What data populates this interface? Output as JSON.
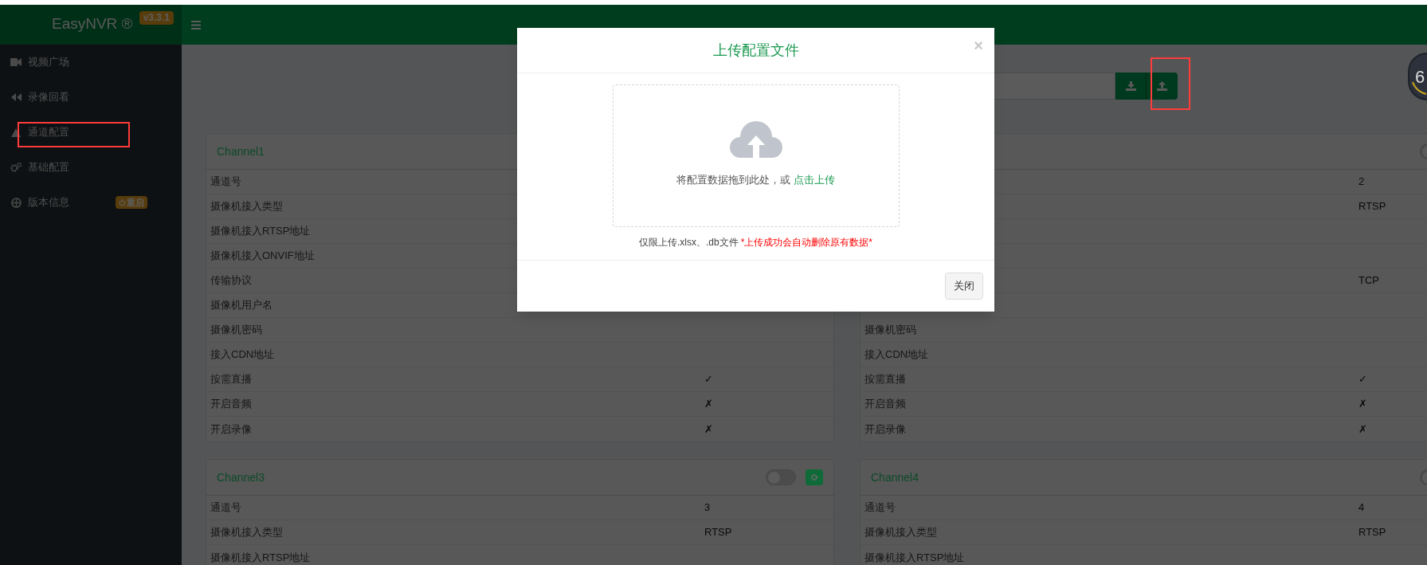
{
  "header": {
    "brand": "EasyNVR ®",
    "version": "v3.3.1"
  },
  "sidebar": {
    "items": [
      {
        "label": "视频广场",
        "selected": false
      },
      {
        "label": "录像回看",
        "selected": false
      },
      {
        "label": "通道配置",
        "selected": false
      },
      {
        "label": "基础配置",
        "selected": false
      },
      {
        "label": "版本信息",
        "selected": false,
        "badge": "重启"
      }
    ]
  },
  "progress_badge": {
    "value": "6"
  },
  "cards": [
    {
      "title": "Channel1",
      "rows": [
        {
          "label": "通道号"
        },
        {
          "label": "摄像机接入类型"
        },
        {
          "label": "摄像机接入RTSP地址"
        },
        {
          "label": "摄像机接入ONVIF地址"
        },
        {
          "label": "传输协议"
        },
        {
          "label": "摄像机用户名"
        },
        {
          "label": "摄像机密码"
        },
        {
          "label": "接入CDN地址"
        },
        {
          "label": "按需直播",
          "value": "✓"
        },
        {
          "label": "开启音频",
          "value": "✗"
        },
        {
          "label": "开启录像",
          "value": "✗"
        }
      ]
    },
    {
      "toggle": {
        "on": false
      },
      "rows": [
        {
          "value": "2"
        },
        {
          "value": "RTSP"
        },
        {},
        {},
        {
          "value": "TCP"
        },
        {},
        {
          "label": "摄像机密码"
        },
        {
          "label": "接入CDN地址"
        },
        {
          "label": "按需直播",
          "value": "✓"
        },
        {
          "label": "开启音频",
          "value": "✗"
        },
        {
          "label": "开启录像",
          "value": "✗"
        }
      ]
    },
    {
      "title": "Channel3",
      "toggle": {
        "on": false
      },
      "settings": true,
      "rows": [
        {
          "label": "通道号",
          "value": "3"
        },
        {
          "label": "摄像机接入类型",
          "value": "RTSP"
        },
        {
          "label": "摄像机接入RTSP地址"
        }
      ]
    },
    {
      "title": "Channel4",
      "toggle": {
        "on": false
      },
      "rows": [
        {
          "label": "通道号",
          "value": "4"
        },
        {
          "label": "摄像机接入类型",
          "value": "RTSP"
        },
        {
          "label": "摄像机接入RTSP地址"
        }
      ]
    }
  ],
  "modal": {
    "title": "上传配置文件",
    "close": "×",
    "drop_text": "将配置数据拖到此处，或 ",
    "drop_link": "点击上传",
    "note": "仅限上传.xlsx、.db文件",
    "warning": "*上传成功会自动删除原有数据*",
    "button": "关闭"
  }
}
